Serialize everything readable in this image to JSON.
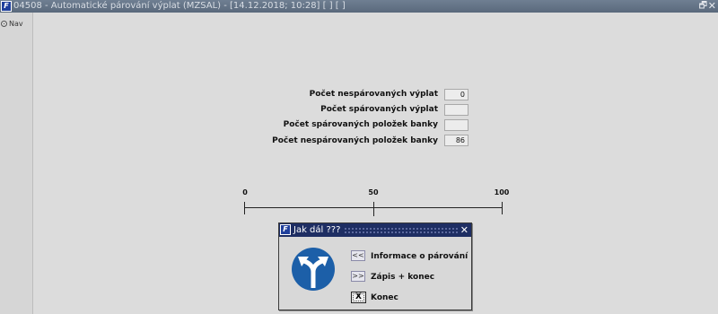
{
  "window": {
    "app_icon": "app-logo-icon",
    "title": "04508 - Automatické párování výplat (MZSAL) - [14.12.2018; 10:28]  [ ]  [ ]",
    "restore_icon": "restore-icon",
    "close_icon": "close-icon"
  },
  "nav": {
    "label": "Nav",
    "icon": "gear-icon"
  },
  "form": {
    "fields": [
      {
        "label": "Počet nespárovaných výplat",
        "value": "0"
      },
      {
        "label": "Počet spárovaných výplat",
        "value": ""
      },
      {
        "label": "Počet spárovaných položek banky",
        "value": ""
      },
      {
        "label": "Počet nespárovaných položek banky",
        "value": "86"
      }
    ]
  },
  "scale": {
    "ticks": [
      "0",
      "50",
      "100"
    ]
  },
  "dialog": {
    "title": "Jak dál ???",
    "close_icon": "close-icon",
    "sign_icon": "road-fork-sign-icon",
    "options": [
      {
        "button": "<<",
        "label": "Informace o párování"
      },
      {
        "button": ">>",
        "label": "Zápis + konec"
      },
      {
        "button": "X",
        "label": "Konec"
      }
    ]
  }
}
